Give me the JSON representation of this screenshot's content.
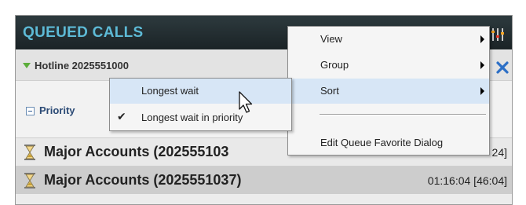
{
  "panel": {
    "title": "QUEUED CALLS",
    "hotline": {
      "label": "Hotline 2025551000"
    },
    "priority": {
      "label": "Priority"
    },
    "queues": [
      {
        "name": "Major Accounts (202555103",
        "time": "24]"
      },
      {
        "name": "Major Accounts (2025551037)",
        "time": "01:16:04  [46:04]"
      }
    ]
  },
  "menu": {
    "items": [
      {
        "label": "View",
        "has_submenu": true
      },
      {
        "label": "Group",
        "has_submenu": true
      },
      {
        "label": "Sort",
        "has_submenu": true,
        "highlighted": true
      },
      {
        "label": "Edit Queue Favorite Dialog",
        "has_submenu": false
      }
    ]
  },
  "sort_submenu": {
    "items": [
      {
        "label": "Longest wait",
        "checked": false,
        "highlighted": true
      },
      {
        "label": "Longest wait in priority",
        "checked": true,
        "check_glyph": "✔"
      }
    ]
  },
  "icons": {
    "settings": "settings-bars-icon",
    "close": "close-icon",
    "expand": "triangle-down-icon",
    "collapse": "minus-box-icon",
    "queue": "hourglass-icon",
    "cursor": "mouse-pointer-icon"
  },
  "colors": {
    "title_text": "#5dbad6",
    "titlebar_bg": "#1f292c",
    "close_blue": "#2c6fc6",
    "menu_highlight": "#d7e6f6",
    "expand_green": "#5cae3b"
  }
}
